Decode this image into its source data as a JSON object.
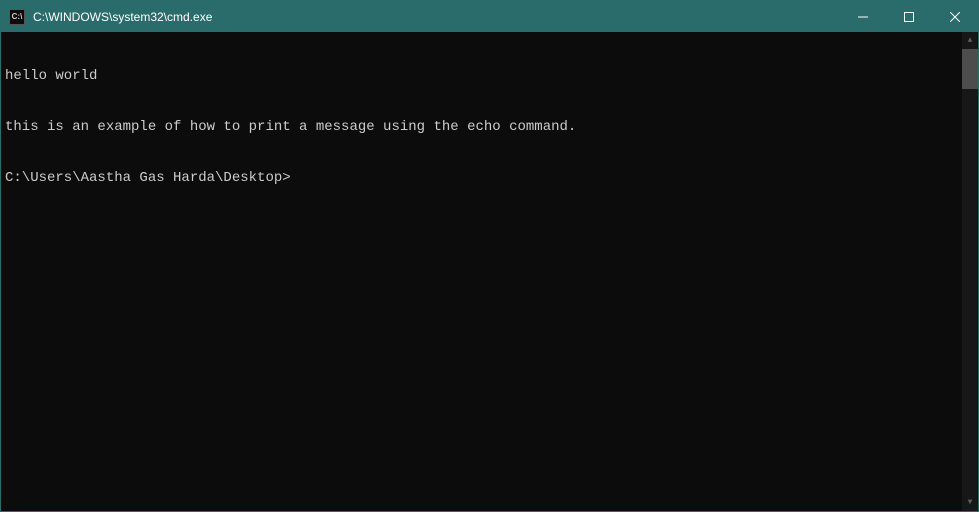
{
  "titlebar": {
    "icon_label": "C:\\",
    "title": "C:\\WINDOWS\\system32\\cmd.exe"
  },
  "terminal": {
    "lines": [
      "hello world",
      "this is an example of how to print a message using the echo command.",
      "C:\\Users\\Aastha Gas Harda\\Desktop>"
    ]
  }
}
